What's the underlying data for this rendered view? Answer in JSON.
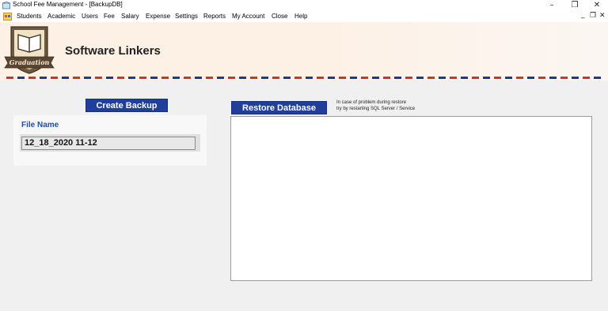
{
  "window": {
    "title": "School Fee Management - [BackupDB]",
    "controls": {
      "minimize": "–",
      "maximize": "❐",
      "close": "✕"
    }
  },
  "menu": {
    "items": [
      "Students",
      "Academic",
      "Users",
      "Fee",
      "Salary",
      "Expense",
      "Settings",
      "Reports",
      "My Account",
      "Close",
      "Help"
    ],
    "mdi_controls": {
      "minimize": "_",
      "restore": "❐",
      "close": "✕"
    }
  },
  "header": {
    "logo_text": "Graduation",
    "brand": "Software Linkers"
  },
  "backup": {
    "create_label": "Create Backup",
    "file_name_label": "File Name",
    "file_name_value": "12_18_2020 11-12"
  },
  "restore": {
    "restore_label": "Restore Database",
    "note_line1": "In case of problem during restore",
    "note_line2": "try by restarting SQL Server / Service"
  },
  "colors": {
    "button_blue": "#1f3f9a",
    "label_blue": "#1e4fa0",
    "stripe_red": "#c0392b",
    "stripe_blue": "#1e3a8a"
  }
}
